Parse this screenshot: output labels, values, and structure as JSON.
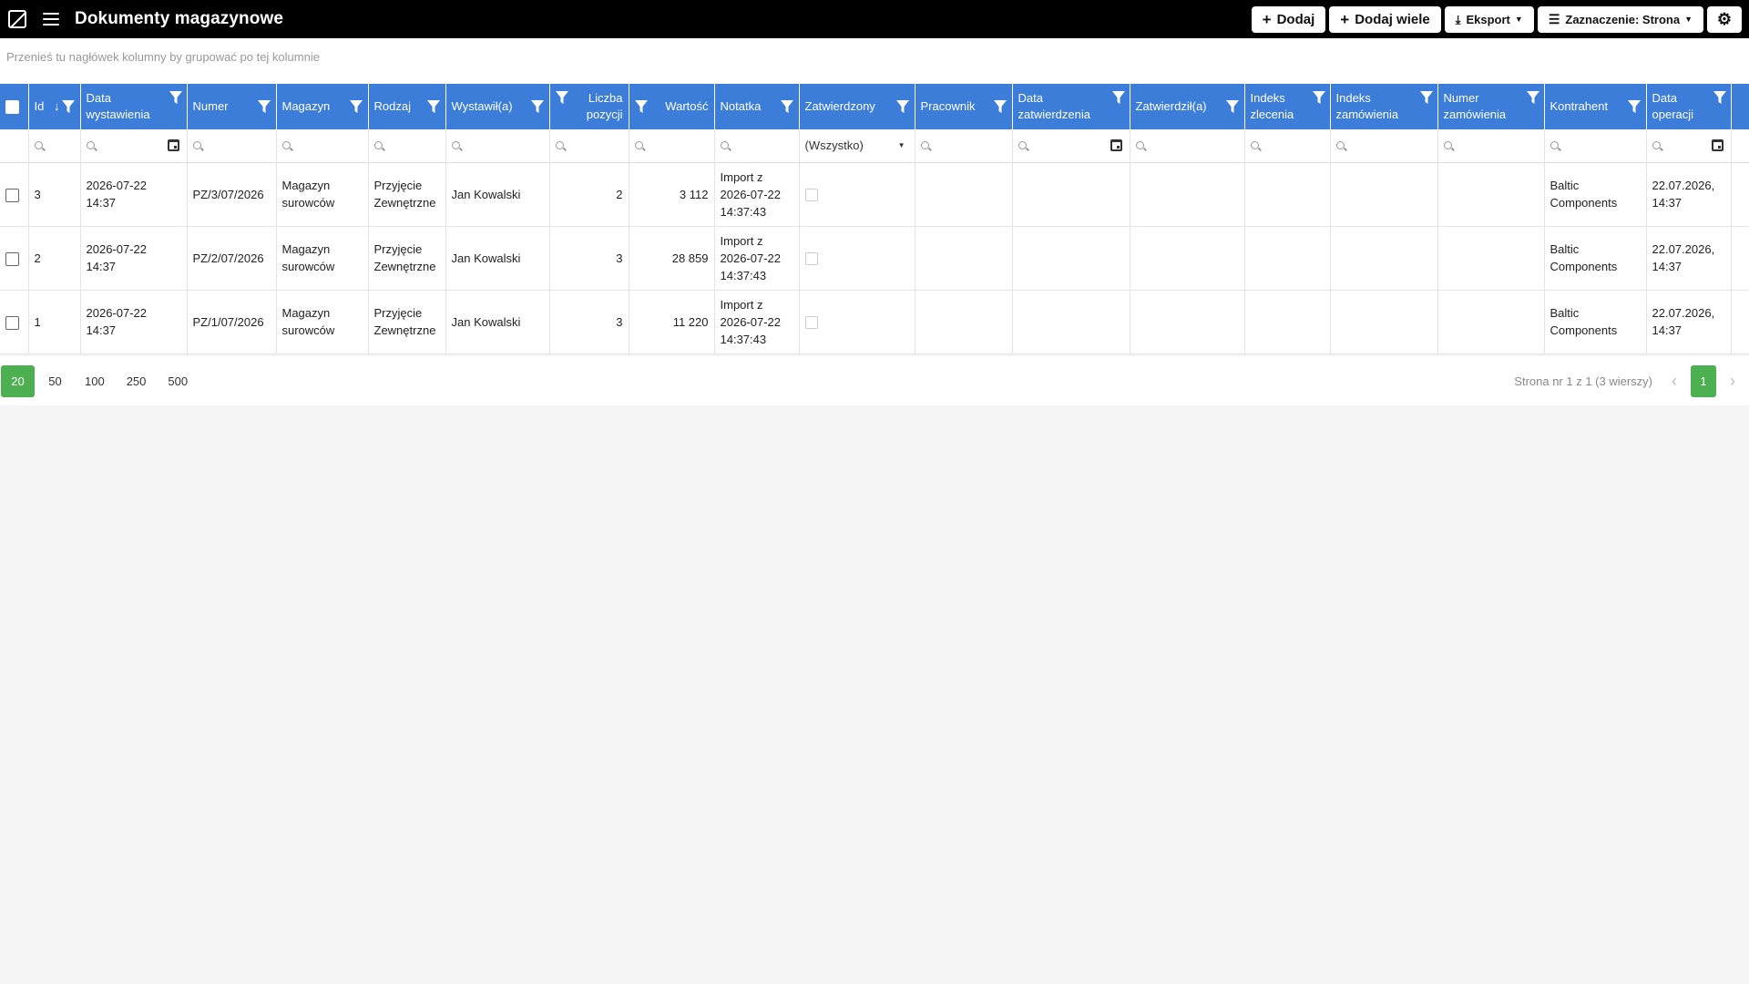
{
  "app": {
    "title": "Dokumenty magazynowe",
    "buttons": {
      "add": "Dodaj",
      "add_many": "Dodaj wiele",
      "export": "Eksport",
      "selection": "Zaznaczenie: Strona"
    }
  },
  "group_hint": "Przenieś tu nagłówek kolumny by grupować po tej kolumnie",
  "columns": {
    "id": "Id",
    "data_wyst_1": "Data",
    "data_wyst_2": "wystawienia",
    "numer": "Numer",
    "magazyn": "Magazyn",
    "rodzaj": "Rodzaj",
    "wystawil": "Wystawił(a)",
    "liczba_1": "Liczba",
    "liczba_2": "pozycji",
    "wartosc": "Wartość",
    "notatka": "Notatka",
    "zatwierdzony": "Zatwierdzony",
    "pracownik": "Pracownik",
    "data_zatw_1": "Data",
    "data_zatw_2": "zatwierdzenia",
    "zatwierdzil": "Zatwierdził(a)",
    "indeks_zlec_1": "Indeks",
    "indeks_zlec_2": "zlecenia",
    "indeks_zam_1": "Indeks",
    "indeks_zam_2": "zamówienia",
    "numer_zam_1": "Numer",
    "numer_zam_2": "zamówienia",
    "kontrahent": "Kontrahent",
    "data_op_1": "Data",
    "data_op_2": "operacji"
  },
  "filters": {
    "zatwierdzony_select": "(Wszystko)"
  },
  "rows": [
    {
      "id": "3",
      "data_1": "2026-07-22",
      "data_2": "14:37",
      "numer": "PZ/3/07/2026",
      "magazyn_1": "Magazyn",
      "magazyn_2": "surowców",
      "rodzaj_1": "Przyjęcie",
      "rodzaj_2": "Zewnętrzne",
      "wystawil": "Jan Kowalski",
      "liczba": "2",
      "wartosc": "3 112",
      "notatka_1": "Import z",
      "notatka_2": "2026-07-22",
      "notatka_3": "14:37:43",
      "kontrahent_1": "Baltic",
      "kontrahent_2": "Components",
      "data_op_1": "22.07.2026,",
      "data_op_2": "14:37"
    },
    {
      "id": "2",
      "data_1": "2026-07-22",
      "data_2": "14:37",
      "numer": "PZ/2/07/2026",
      "magazyn_1": "Magazyn",
      "magazyn_2": "surowców",
      "rodzaj_1": "Przyjęcie",
      "rodzaj_2": "Zewnętrzne",
      "wystawil": "Jan Kowalski",
      "liczba": "3",
      "wartosc": "28 859",
      "notatka_1": "Import z",
      "notatka_2": "2026-07-22",
      "notatka_3": "14:37:43",
      "kontrahent_1": "Baltic",
      "kontrahent_2": "Components",
      "data_op_1": "22.07.2026,",
      "data_op_2": "14:37"
    },
    {
      "id": "1",
      "data_1": "2026-07-22",
      "data_2": "14:37",
      "numer": "PZ/1/07/2026",
      "magazyn_1": "Magazyn",
      "magazyn_2": "surowców",
      "rodzaj_1": "Przyjęcie",
      "rodzaj_2": "Zewnętrzne",
      "wystawil": "Jan Kowalski",
      "liczba": "3",
      "wartosc": "11 220",
      "notatka_1": "Import z",
      "notatka_2": "2026-07-22",
      "notatka_3": "14:37:43",
      "kontrahent_1": "Baltic",
      "kontrahent_2": "Components",
      "data_op_1": "22.07.2026,",
      "data_op_2": "14:37"
    }
  ],
  "pager": {
    "sizes": [
      "20",
      "50",
      "100",
      "250",
      "500"
    ],
    "active_size": "20",
    "info": "Strona nr 1 z 1 (3 wierszy)",
    "current_page": "1"
  },
  "colors": {
    "header_blue": "#3b7dd8",
    "pager_green": "#4caf50",
    "topbar": "#000000"
  },
  "icons": [
    "logo-icon",
    "menu-icon",
    "plus-icon",
    "export-icon",
    "sliders-icon",
    "gear-icon",
    "filter-icon",
    "sort-down-icon",
    "search-icon",
    "calendar-icon",
    "chevron-left-icon",
    "chevron-right-icon"
  ]
}
